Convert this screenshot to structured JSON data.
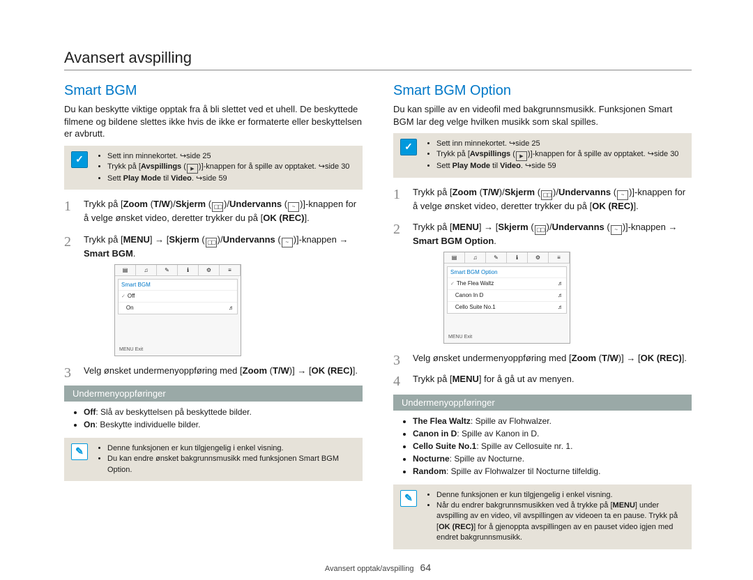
{
  "page": {
    "title": "Avansert avspilling",
    "footer_label": "Avansert opptak/avspilling",
    "page_number": "64"
  },
  "left": {
    "heading": "Smart BGM",
    "intro": "Du kan beskytte viktige opptak fra å bli slettet ved et uhell. De beskyttede filmene og bildene slettes ikke hvis de ikke er formaterte eller beskyttelsen er avbrutt.",
    "reqs": [
      {
        "prefix": "Sett inn minnekortet. ",
        "suffix": "side 25"
      },
      {
        "prefix": "Trykk på [",
        "bold": "Avspillings",
        "mid": " (",
        "icon": "play",
        "after": ")]-knappen for å spille av opptaket. ",
        "suffix": "side 30"
      },
      {
        "prefix": "Sett ",
        "bold1": "Play Mode",
        "mid": " til ",
        "bold2": "Video",
        "after": ". ",
        "suffix": "side 59"
      }
    ],
    "step1_a": "Trykk på [",
    "step1_b": "Zoom",
    "step1_c": " (",
    "step1_d": "T/W",
    "step1_e": ")/",
    "step1_f": "Skjerm",
    "step1_g": " (",
    "step1_h": ")/",
    "step1_i": "Undervanns",
    "step1_j": " (",
    "step1_k": ")]-knappen for å velge ønsket video, deretter trykker du på [",
    "step1_l": "OK (REC)",
    "step1_m": "].",
    "step2_a": "Trykk på [",
    "step2_b": "MENU",
    "step2_c": "] → [",
    "step2_d": "Skjerm",
    "step2_e": " (",
    "step2_f": ")/",
    "step2_g": "Undervanns",
    "step2_h": " (",
    "step2_i": ")]-knappen → ",
    "step2_j": "Smart BGM",
    "step2_k": ".",
    "step3_a": "Velg ønsket undermenyoppføring med [",
    "step3_b": "Zoom",
    "step3_c": " (",
    "step3_d": "T/W",
    "step3_e": ")] → [",
    "step3_f": "OK (REC)",
    "step3_g": "].",
    "screencap_title": "Smart BGM",
    "screencap_rows": [
      "Off",
      "On"
    ],
    "screencap_exit": "Exit",
    "submenu_header": "Undermenyoppføringer",
    "submenu": [
      {
        "name": "Off",
        "desc": ": Slå av beskyttelsen på beskyttede bilder."
      },
      {
        "name": "On",
        "desc": ": Beskytte individuelle bilder."
      }
    ],
    "notes": [
      "Denne funksjonen er kun tilgjengelig i enkel visning.",
      "Du kan endre ønsket bakgrunnsmusikk med funksjonen Smart BGM Option."
    ]
  },
  "right": {
    "heading": "Smart BGM Option",
    "intro": "Du kan spille av en videofil med bakgrunnsmusikk. Funksjonen Smart BGM lar deg velge hvilken musikk som skal spilles.",
    "reqs": [
      {
        "prefix": "Sett inn minnekortet. ",
        "suffix": "side 25"
      },
      {
        "prefix": "Trykk på [",
        "bold": "Avspillings",
        "mid": " (",
        "icon": "play",
        "after": ")]-knappen for å spille av opptaket. ",
        "suffix": "side 30"
      },
      {
        "prefix": "Sett ",
        "bold1": "Play Mode",
        "mid": " til ",
        "bold2": "Video",
        "after": ". ",
        "suffix": "side 59"
      }
    ],
    "step1_a": "Trykk på [",
    "step1_b": "Zoom",
    "step1_c": " (",
    "step1_d": "T/W",
    "step1_e": ")/",
    "step1_f": "Skjerm",
    "step1_g": " (",
    "step1_h": ")/",
    "step1_i": "Undervanns",
    "step1_j": " (",
    "step1_k": ")]-knappen for å velge ønsket video, deretter trykker du på [",
    "step1_l": "OK (REC)",
    "step1_m": "].",
    "step2_a": "Trykk på [",
    "step2_b": "MENU",
    "step2_c": "] → [",
    "step2_d": "Skjerm",
    "step2_e": " (",
    "step2_f": ")/",
    "step2_g": "Undervanns",
    "step2_h": " (",
    "step2_i": ")]-knappen → ",
    "step2_j": "Smart BGM Option",
    "step2_k": ".",
    "step3_a": "Velg ønsket undermenyoppføring med [",
    "step3_b": "Zoom",
    "step3_c": " (",
    "step3_d": "T/W",
    "step3_e": ")] → [",
    "step3_f": "OK (REC)",
    "step3_g": "].",
    "step4_a": "Trykk på [",
    "step4_b": "MENU",
    "step4_c": "] for å gå ut av menyen.",
    "screencap_title": "Smart BGM Option",
    "screencap_rows": [
      "The Flea Waltz",
      "Canon In D",
      "Cello Suite No.1"
    ],
    "screencap_exit": "Exit",
    "submenu_header": "Undermenyoppføringer",
    "submenu": [
      {
        "name": "The Flea Waltz",
        "desc": ": Spille av Flohwalzer."
      },
      {
        "name": "Canon in D",
        "desc": ": Spille av Kanon in D."
      },
      {
        "name": "Cello Suite No.1",
        "desc": ": Spille av Cellosuite nr. 1."
      },
      {
        "name": "Nocturne",
        "desc": ": Spille av Nocturne."
      },
      {
        "name": "Random",
        "desc": ": Spille av Flohwalzer til Nocturne tilfeldig."
      }
    ],
    "notes_line1": "Denne funksjonen er kun tilgjengelig i enkel visning.",
    "notes_line2a": "Når du endrer bakgrunnsmusikken ved å trykke på [",
    "notes_line2b": "MENU",
    "notes_line2c": "] under avspilling av en video, vil avspillingen av videoen ta en pause. Trykk på [",
    "notes_line2d": "OK (REC)",
    "notes_line2e": "] for å gjenoppta avspillingen av en pauset video igjen med endret bakgrunnsmusikk."
  }
}
